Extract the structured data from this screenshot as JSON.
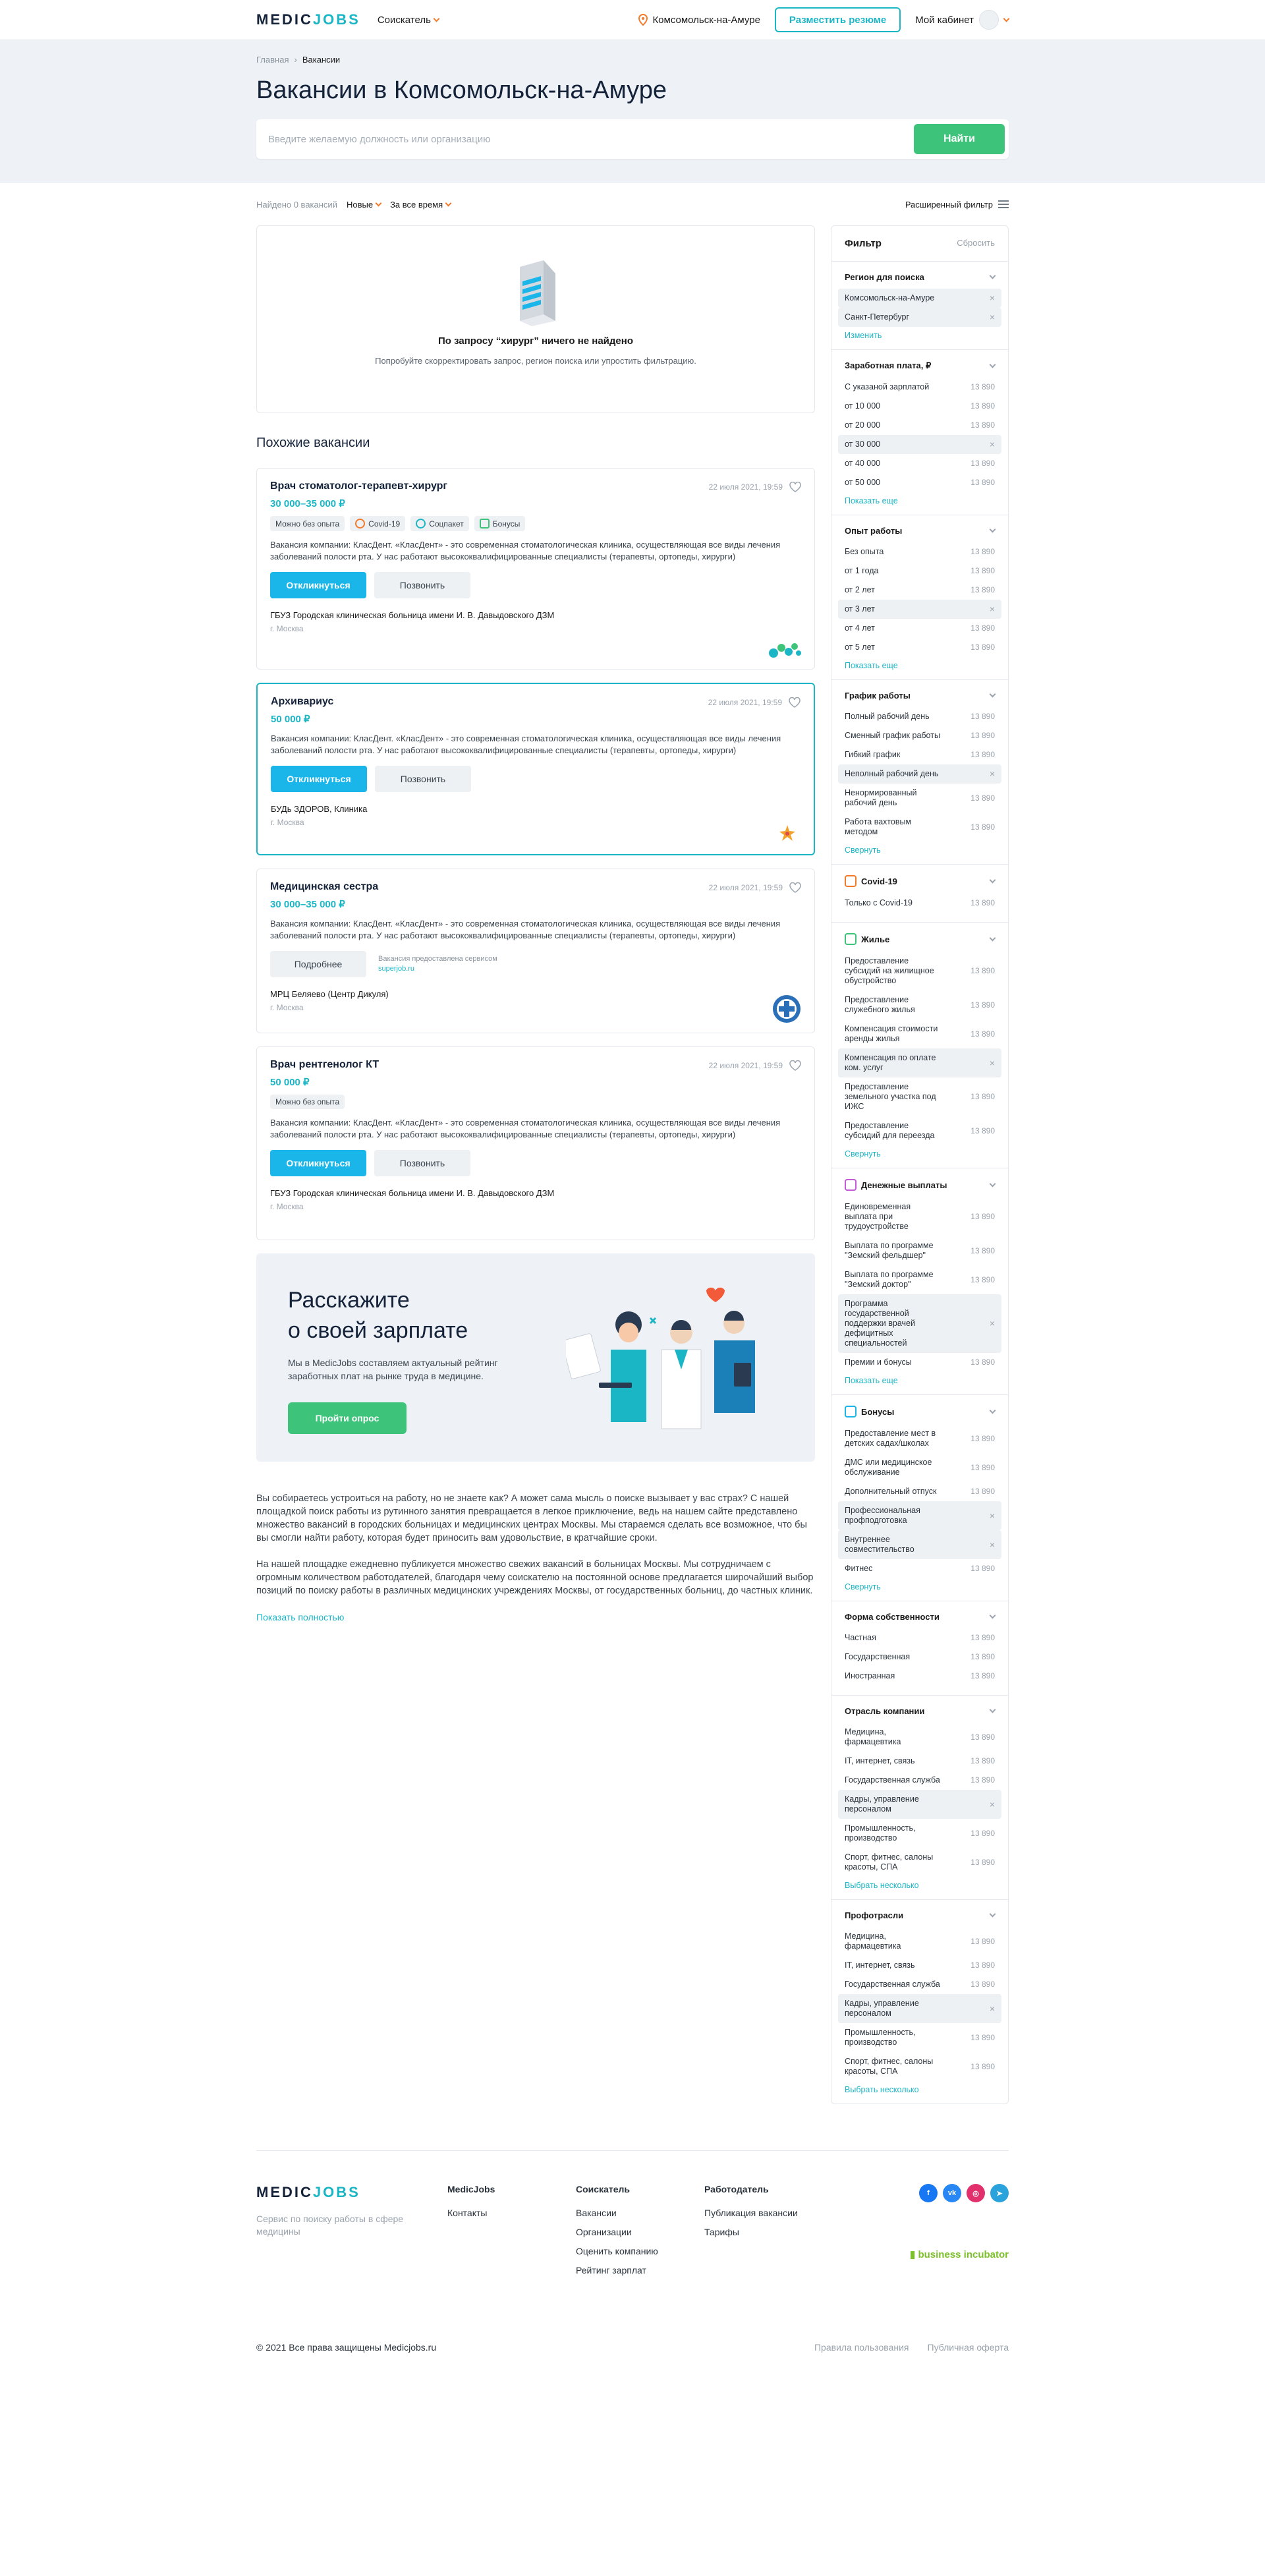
{
  "header": {
    "logo_a": "MEDIC",
    "logo_b": "JOBS",
    "role": "Соискатель",
    "city": "Комсомольск-на-Амуре",
    "post_resume": "Разместить резюме",
    "cabinet": "Мой кабинет"
  },
  "hero": {
    "crumb_home": "Главная",
    "crumb_current": "Вакансии",
    "title": "Вакансии в Комсомольск-на-Амуре",
    "search_placeholder": "Введите желаемую должность или организацию",
    "search_button": "Найти"
  },
  "sortbar": {
    "found": "Найдено 0 вакансий",
    "sort": "Новые",
    "period": "За все время",
    "advanced": "Расширенный фильтр"
  },
  "empty": {
    "title": "По запросу “хирург” ничего не найдено",
    "subtitle": "Попробуйте скорректировать запрос, регион поиска или упростить фильтрацию."
  },
  "similar_title": "Похожие вакансии",
  "vacancies": [
    {
      "title": "Врач стоматолог-терапевт-хирург",
      "salary": "30 000–35 000 ₽",
      "date": "22 июля 2021, 19:59",
      "tags": [
        "Можно без опыта",
        "Covid-19",
        "Соцпакет",
        "Бонусы"
      ],
      "desc": "Вакансия компании: КласДент. «КласДент» - это современная стоматологическая клиника, осуществляющая все виды лечения заболеваний полости рта. У нас работают высококвалифицированные специалисты (терапевты, ортопеды, хирурги)",
      "apply": "Откликнуться",
      "call": "Позвонить",
      "org": "ГБУЗ Городская клиническая больница имени И. В. Давыдовского ДЗМ",
      "loc": "г. Москва"
    },
    {
      "title": "Архивариус",
      "salary": "50 000 ₽",
      "date": "22 июля 2021, 19:59",
      "desc": "Вакансия компании: КласДент. «КласДент» - это современная стоматологическая клиника, осуществляющая все виды лечения заболеваний полости рта. У нас работают высококвалифицированные специалисты (терапевты, ортопеды, хирурги)",
      "apply": "Откликнуться",
      "call": "Позвонить",
      "org": "БУДь ЗДОРОВ, Клиника",
      "loc": "г. Москва"
    },
    {
      "title": "Медицинская сестра",
      "salary": "30 000–35 000 ₽",
      "date": "22 июля 2021, 19:59",
      "desc": "Вакансия компании: КласДент. «КласДент» - это современная стоматологическая клиника, осуществляющая все виды лечения заболеваний полости рта. У нас работают высококвалифицированные специалисты (терапевты, ортопеды, хирурги)",
      "details": "Подробнее",
      "service": "Вакансия предоставлена сервисом",
      "service_link": "superjob.ru",
      "org": "МРЦ Беляево (Центр Дикуля)",
      "loc": "г. Москва"
    },
    {
      "title": "Врач рентгенолог КТ",
      "salary": "50 000 ₽",
      "date": "22 июля 2021, 19:59",
      "tags": [
        "Можно без опыта"
      ],
      "desc": "Вакансия компании: КласДент. «КласДент» - это современная стоматологическая клиника, осуществляющая все виды лечения заболеваний полости рта. У нас работают высококвалифицированные специалисты (терапевты, ортопеды, хирурги)",
      "apply": "Откликнуться",
      "call": "Позвонить",
      "org": "ГБУЗ Городская клиническая больница имени И. В. Давыдовского ДЗМ",
      "loc": "г. Москва"
    }
  ],
  "promo": {
    "title1": "Расскажите",
    "title2": "о своей зарплате",
    "text": "Мы в MedicJobs составляем актуальный рейтинг заработных плат на рынке труда в медицине.",
    "button": "Пройти опрос"
  },
  "seo": {
    "p1": "Вы собираетесь устроиться на работу, но не знаете как? А может сама мысль о поиске вызывает у вас страх? С нашей площадкой поиск работы из рутинного занятия превращается в легкое приключение, ведь на нашем сайте представлено множество вакансий в городских больницах и медицинских центрах Москвы. Мы стараемся сделать все возможное, что бы вы смогли найти работу, которая будет приносить вам удовольствие, в кратчайшие сроки.",
    "p2": "На нашей площадке ежедневно публикуется множество свежих вакансий в больницах Москвы. Мы сотрудничаем с огромным количеством работодателей, благодаря чему соискателю на постоянной основе предлагается широчайший выбор позиций по поиску работы в различных медицинских учреждениях Москвы, от государственных больниц, до частных клиник.",
    "more": "Показать полностью"
  },
  "filter": {
    "title": "Фильтр",
    "reset": "Сбросить",
    "region": {
      "title": "Регион для поиска",
      "items": [
        "Комсомольск-на-Амуре",
        "Санкт-Петербург"
      ],
      "link": "Изменить"
    },
    "salary": {
      "title": "Заработная плата, ₽",
      "items": [
        {
          "n": "С указаной зарплатой",
          "c": "13 890"
        },
        {
          "n": "от 10 000",
          "c": "13 890"
        },
        {
          "n": "от 20 000",
          "c": "13 890"
        },
        {
          "n": "от 30 000",
          "c": "",
          "on": true
        },
        {
          "n": "от 40 000",
          "c": "13 890"
        },
        {
          "n": "от 50 000",
          "c": "13 890"
        }
      ],
      "link": "Показать еще"
    },
    "exp": {
      "title": "Опыт работы",
      "items": [
        {
          "n": "Без опыта",
          "c": "13 890"
        },
        {
          "n": "от 1 года",
          "c": "13 890"
        },
        {
          "n": "от 2 лет",
          "c": "13 890"
        },
        {
          "n": "от 3 лет",
          "c": "",
          "on": true
        },
        {
          "n": "от 4 лет",
          "c": "13 890"
        },
        {
          "n": "от 5 лет",
          "c": "13 890"
        }
      ],
      "link": "Показать еще"
    },
    "schedule": {
      "title": "График работы",
      "items": [
        {
          "n": "Полный рабочий день",
          "c": "13 890"
        },
        {
          "n": "Сменный график работы",
          "c": "13 890"
        },
        {
          "n": "Гибкий график",
          "c": "13 890"
        },
        {
          "n": "Неполный рабочий день",
          "c": "",
          "on": true
        },
        {
          "n": "Ненормированный рабочий день",
          "c": "13 890"
        },
        {
          "n": "Работа вахтовым методом",
          "c": "13 890"
        }
      ],
      "link": "Свернуть"
    },
    "covid": {
      "title": "Covid-19",
      "items": [
        {
          "n": "Только с Covid-19",
          "c": "13 890"
        }
      ]
    },
    "housing": {
      "title": "Жилье",
      "items": [
        {
          "n": "Предоставление субсидий на жилищное обустройство",
          "c": "13 890"
        },
        {
          "n": "Предоставление служебного жилья",
          "c": "13 890"
        },
        {
          "n": "Компенсация стоимости аренды жилья",
          "c": "13 890"
        },
        {
          "n": "Компенсация по оплате ком. услуг",
          "c": "",
          "on": true
        },
        {
          "n": "Предоставление земельного участка под ИЖС",
          "c": "13 890"
        },
        {
          "n": "Предоставление субсидий для переезда",
          "c": "13 890"
        }
      ],
      "link": "Свернуть"
    },
    "money": {
      "title": "Денежные выплаты",
      "items": [
        {
          "n": "Единовременная выплата при трудоустройстве",
          "c": "13 890"
        },
        {
          "n": "Выплата по программе \"Земский фельдшер\"",
          "c": "13 890"
        },
        {
          "n": "Выплата по программе \"Земский доктор\"",
          "c": "13 890"
        },
        {
          "n": "Программа государственной поддержки врачей дефицитных специальностей",
          "c": "",
          "on": true
        },
        {
          "n": "Премии и бонусы",
          "c": "13 890"
        }
      ],
      "link": "Показать еще"
    },
    "bonus": {
      "title": "Бонусы",
      "items": [
        {
          "n": "Предоставление мест в детских садах/школах",
          "c": "13 890"
        },
        {
          "n": "ДМС или медицинское обслуживание",
          "c": "13 890"
        },
        {
          "n": "Дополнительный отпуск",
          "c": "13 890"
        },
        {
          "n": "Профессиональная профподготовка",
          "c": "",
          "on": true
        },
        {
          "n": "Внутреннее совместительство",
          "c": "",
          "on": true
        },
        {
          "n": "Фитнес",
          "c": "13 890"
        }
      ],
      "link": "Свернуть"
    },
    "ownership": {
      "title": "Форма собственности",
      "items": [
        {
          "n": "Частная",
          "c": "13 890"
        },
        {
          "n": "Государственная",
          "c": "13 890"
        },
        {
          "n": "Иностранная",
          "c": "13 890"
        }
      ]
    },
    "industry": {
      "title": "Отрасль компании",
      "items": [
        {
          "n": "Медицина, фармацевтика",
          "c": "13 890"
        },
        {
          "n": "IT, интернет, связь",
          "c": "13 890"
        },
        {
          "n": "Государственная служба",
          "c": "13 890"
        },
        {
          "n": "Кадры, управление персоналом",
          "c": "",
          "on": true
        },
        {
          "n": "Промышленность, производство",
          "c": "13 890"
        },
        {
          "n": "Спорт, фитнес, салоны красоты, СПА",
          "c": "13 890"
        }
      ],
      "link": "Выбрать несколько"
    },
    "prof": {
      "title": "Профотрасли",
      "items": [
        {
          "n": "Медицина, фармацевтика",
          "c": "13 890"
        },
        {
          "n": "IT, интернет, связь",
          "c": "13 890"
        },
        {
          "n": "Государственная служба",
          "c": "13 890"
        },
        {
          "n": "Кадры, управление персоналом",
          "c": "",
          "on": true
        },
        {
          "n": "Промышленность, производство",
          "c": "13 890"
        },
        {
          "n": "Спорт, фитнес, салоны красоты, СПА",
          "c": "13 890"
        }
      ],
      "link": "Выбрать несколько"
    }
  },
  "footer": {
    "tagline": "Сервис по поиску работы в сфере медицины",
    "col1_title": "MedicJobs",
    "col1": [
      "Контакты"
    ],
    "col2_title": "Соискатель",
    "col2": [
      "Вакансии",
      "Организации",
      "Оценить компанию",
      "Рейтинг зарплат"
    ],
    "col3_title": "Работодатель",
    "col3": [
      "Публикация вакансии",
      "Тарифы"
    ],
    "incubator": "business incubator",
    "copyright": "© 2021 Все права защищены Medicjobs.ru",
    "terms": "Правила пользования",
    "offer": "Публичная оферта"
  },
  "colors": {
    "accent": "#1bb6c6",
    "green": "#3dc47a",
    "blue": "#1bb6e9",
    "orange": "#f27a2a"
  }
}
